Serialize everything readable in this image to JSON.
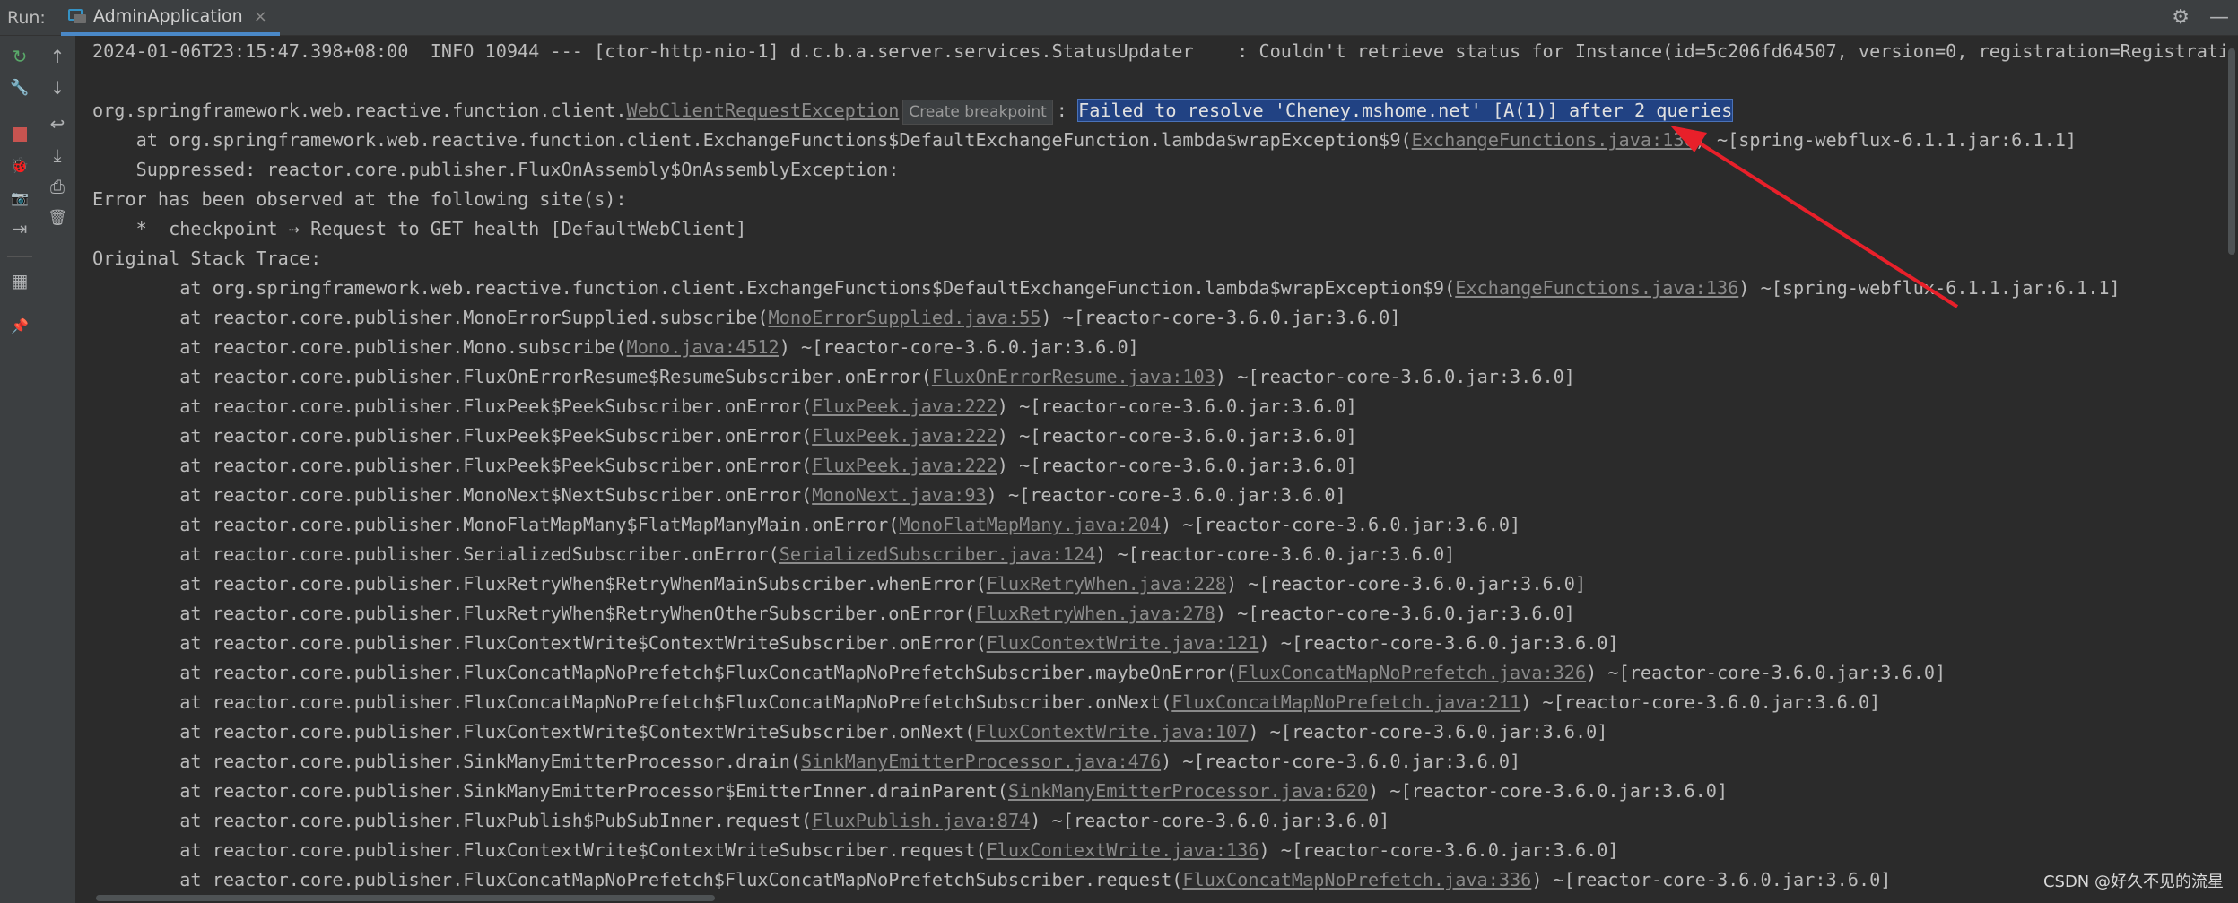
{
  "header": {
    "run_label": "Run:",
    "tab_label": "AdminApplication",
    "tab_close": "×",
    "settings_glyph": "⚙",
    "hide_glyph": "—"
  },
  "toolbar": {
    "rerun_glyph": "↻",
    "wrench_glyph": "🔧",
    "bug_glyph": "🐞",
    "camera_glyph": "📷",
    "exit_glyph": "⇥",
    "layout_glyph": "▦",
    "pin_glyph": "📌",
    "up_glyph": "↑",
    "down_glyph": "↓",
    "wrap_glyph": "↩",
    "scroll_end_glyph": "⤓",
    "print_glyph": "⎙",
    "trash_glyph": "🗑"
  },
  "console": {
    "log_line": "2024-01-06T23:15:47.398+08:00  INFO 10944 --- [ctor-http-nio-1] d.c.b.a.server.services.StatusUpdater    : Couldn't retrieve status for Instance(id=5c206fd64507, version=0, registration=Registration(",
    "exception": {
      "prefix": "org.springframework.web.reactive.function.client.",
      "link": "WebClientRequestException",
      "tooltip": "Create breakpoint",
      "colon": ": ",
      "message": "Failed to resolve 'Cheney.mshome.net' [A(1)] after 2 queries"
    },
    "at_line": {
      "prefix": "    at org.springframework.web.reactive.function.client.ExchangeFunctions$DefaultExchangeFunction.lambda$wrapException$9(",
      "link": "ExchangeFunctions.java:136",
      "suffix": ") ~[spring-webflux-6.1.1.jar:6.1.1]"
    },
    "suppressed": "    Suppressed: reactor.core.publisher.FluxOnAssembly$OnAssemblyException: ",
    "observed": "Error has been observed at the following site(s):",
    "checkpoint": "    *__checkpoint ⇢ Request to GET health [DefaultWebClient]",
    "original": "Original Stack Trace:",
    "stack": [
      {
        "prefix": "        at org.springframework.web.reactive.function.client.ExchangeFunctions$DefaultExchangeFunction.lambda$wrapException$9(",
        "link": "ExchangeFunctions.java:136",
        "suffix": ") ~[spring-webflux-6.1.1.jar:6.1.1]"
      },
      {
        "prefix": "        at reactor.core.publisher.MonoErrorSupplied.subscribe(",
        "link": "MonoErrorSupplied.java:55",
        "suffix": ") ~[reactor-core-3.6.0.jar:3.6.0]"
      },
      {
        "prefix": "        at reactor.core.publisher.Mono.subscribe(",
        "link": "Mono.java:4512",
        "suffix": ") ~[reactor-core-3.6.0.jar:3.6.0]"
      },
      {
        "prefix": "        at reactor.core.publisher.FluxOnErrorResume$ResumeSubscriber.onError(",
        "link": "FluxOnErrorResume.java:103",
        "suffix": ") ~[reactor-core-3.6.0.jar:3.6.0]"
      },
      {
        "prefix": "        at reactor.core.publisher.FluxPeek$PeekSubscriber.onError(",
        "link": "FluxPeek.java:222",
        "suffix": ") ~[reactor-core-3.6.0.jar:3.6.0]"
      },
      {
        "prefix": "        at reactor.core.publisher.FluxPeek$PeekSubscriber.onError(",
        "link": "FluxPeek.java:222",
        "suffix": ") ~[reactor-core-3.6.0.jar:3.6.0]"
      },
      {
        "prefix": "        at reactor.core.publisher.FluxPeek$PeekSubscriber.onError(",
        "link": "FluxPeek.java:222",
        "suffix": ") ~[reactor-core-3.6.0.jar:3.6.0]"
      },
      {
        "prefix": "        at reactor.core.publisher.MonoNext$NextSubscriber.onError(",
        "link": "MonoNext.java:93",
        "suffix": ") ~[reactor-core-3.6.0.jar:3.6.0]"
      },
      {
        "prefix": "        at reactor.core.publisher.MonoFlatMapMany$FlatMapManyMain.onError(",
        "link": "MonoFlatMapMany.java:204",
        "suffix": ") ~[reactor-core-3.6.0.jar:3.6.0]"
      },
      {
        "prefix": "        at reactor.core.publisher.SerializedSubscriber.onError(",
        "link": "SerializedSubscriber.java:124",
        "suffix": ") ~[reactor-core-3.6.0.jar:3.6.0]"
      },
      {
        "prefix": "        at reactor.core.publisher.FluxRetryWhen$RetryWhenMainSubscriber.whenError(",
        "link": "FluxRetryWhen.java:228",
        "suffix": ") ~[reactor-core-3.6.0.jar:3.6.0]"
      },
      {
        "prefix": "        at reactor.core.publisher.FluxRetryWhen$RetryWhenOtherSubscriber.onError(",
        "link": "FluxRetryWhen.java:278",
        "suffix": ") ~[reactor-core-3.6.0.jar:3.6.0]"
      },
      {
        "prefix": "        at reactor.core.publisher.FluxContextWrite$ContextWriteSubscriber.onError(",
        "link": "FluxContextWrite.java:121",
        "suffix": ") ~[reactor-core-3.6.0.jar:3.6.0]"
      },
      {
        "prefix": "        at reactor.core.publisher.FluxConcatMapNoPrefetch$FluxConcatMapNoPrefetchSubscriber.maybeOnError(",
        "link": "FluxConcatMapNoPrefetch.java:326",
        "suffix": ") ~[reactor-core-3.6.0.jar:3.6.0]"
      },
      {
        "prefix": "        at reactor.core.publisher.FluxConcatMapNoPrefetch$FluxConcatMapNoPrefetchSubscriber.onNext(",
        "link": "FluxConcatMapNoPrefetch.java:211",
        "suffix": ") ~[reactor-core-3.6.0.jar:3.6.0]"
      },
      {
        "prefix": "        at reactor.core.publisher.FluxContextWrite$ContextWriteSubscriber.onNext(",
        "link": "FluxContextWrite.java:107",
        "suffix": ") ~[reactor-core-3.6.0.jar:3.6.0]"
      },
      {
        "prefix": "        at reactor.core.publisher.SinkManyEmitterProcessor.drain(",
        "link": "SinkManyEmitterProcessor.java:476",
        "suffix": ") ~[reactor-core-3.6.0.jar:3.6.0]"
      },
      {
        "prefix": "        at reactor.core.publisher.SinkManyEmitterProcessor$EmitterInner.drainParent(",
        "link": "SinkManyEmitterProcessor.java:620",
        "suffix": ") ~[reactor-core-3.6.0.jar:3.6.0]"
      },
      {
        "prefix": "        at reactor.core.publisher.FluxPublish$PubSubInner.request(",
        "link": "FluxPublish.java:874",
        "suffix": ") ~[reactor-core-3.6.0.jar:3.6.0]"
      },
      {
        "prefix": "        at reactor.core.publisher.FluxContextWrite$ContextWriteSubscriber.request(",
        "link": "FluxContextWrite.java:136",
        "suffix": ") ~[reactor-core-3.6.0.jar:3.6.0]"
      },
      {
        "prefix": "        at reactor.core.publisher.FluxConcatMapNoPrefetch$FluxConcatMapNoPrefetchSubscriber.request(",
        "link": "FluxConcatMapNoPrefetch.java:336",
        "suffix": ") ~[reactor-core-3.6.0.jar:3.6.0]"
      }
    ]
  },
  "watermark": "CSDN @好久不见的流星",
  "colors": {
    "background": "#2b2b2b",
    "selection": "#214283",
    "annotation_arrow": "#e8202a",
    "rerun": "#59a869",
    "stop": "#c75450"
  }
}
